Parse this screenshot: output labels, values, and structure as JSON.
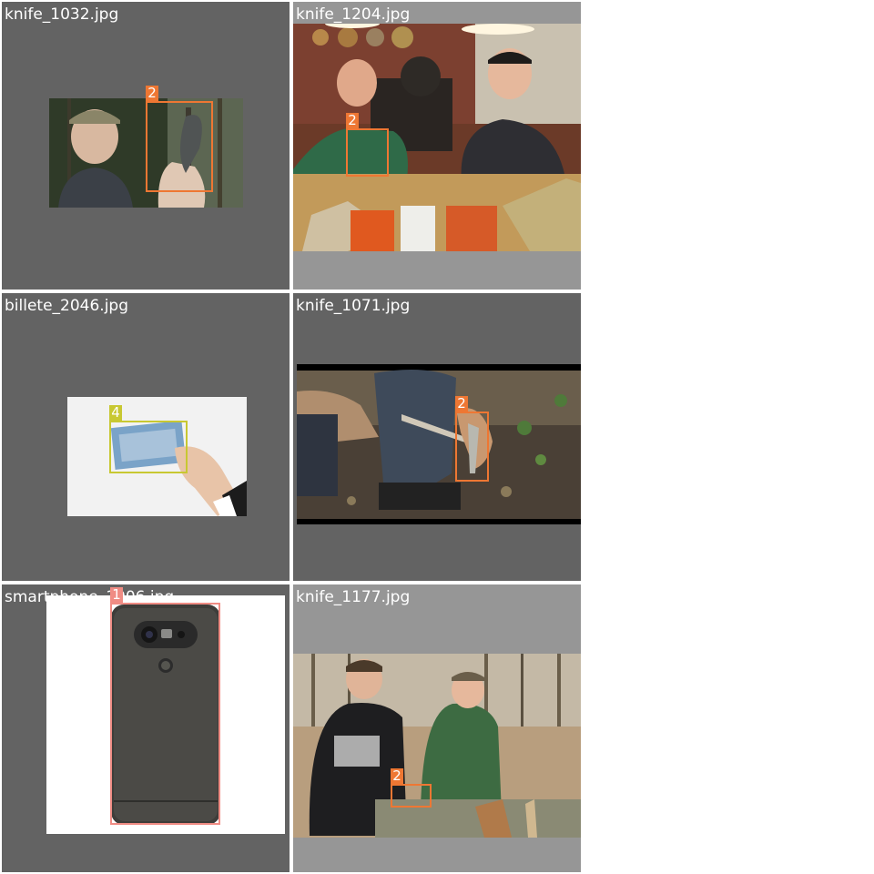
{
  "colors": {
    "knife": "#ee7733",
    "banknote": "#c8c832",
    "smartphone": "#f08c84",
    "tile_dark": "#636363",
    "tile_light": "#969696"
  },
  "tiles": [
    {
      "filename": "knife_1032.jpg",
      "detections": [
        {
          "class_id": "2"
        }
      ]
    },
    {
      "filename": "knife_1204.jpg",
      "detections": [
        {
          "class_id": "2"
        }
      ]
    },
    {
      "filename": "billete_2046.jpg",
      "detections": [
        {
          "class_id": "4"
        }
      ]
    },
    {
      "filename": "knife_1071.jpg",
      "detections": [
        {
          "class_id": "2"
        }
      ]
    },
    {
      "filename": "smartphone_1006.jpg",
      "detections": [
        {
          "class_id": "1"
        }
      ]
    },
    {
      "filename": "knife_1177.jpg",
      "detections": [
        {
          "class_id": "2"
        }
      ]
    }
  ]
}
